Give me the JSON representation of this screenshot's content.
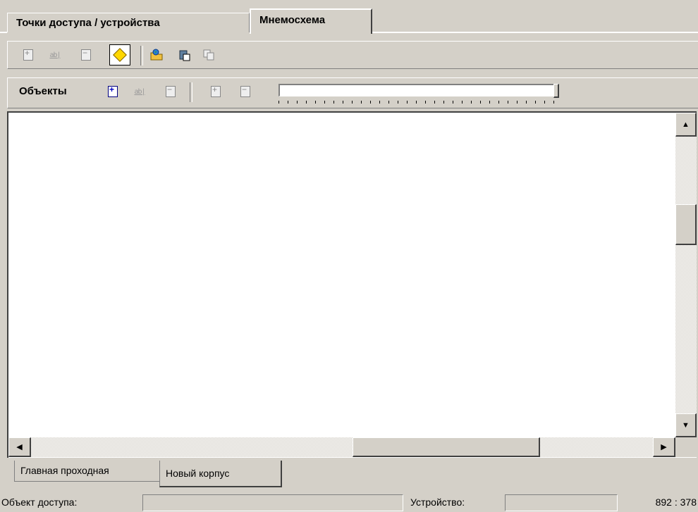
{
  "tabs": {
    "access_points": "Точки доступа / устройства",
    "mnemo": "Мнемосхема"
  },
  "toolbar2": {
    "objects_label": "Объекты"
  },
  "icons": {
    "toolbar1": [
      "add-doc-icon",
      "text-field-icon",
      "remove-doc-icon",
      "select-object-icon",
      "open-folder-icon",
      "paste-icon",
      "copy-icon"
    ],
    "toolbar2": [
      "add-object-icon",
      "text-field-icon",
      "remove-object-icon",
      "add-page-icon",
      "remove-page-icon"
    ]
  },
  "slider": {
    "value_fraction": 1.0
  },
  "bottom_tabs": {
    "main": "Главная проходная",
    "new": "Новый корпус"
  },
  "status": {
    "object_label": "Объект доступа:",
    "object_value": "",
    "device_label": "Устройство:",
    "device_value": "",
    "coords": "892 : 378"
  }
}
